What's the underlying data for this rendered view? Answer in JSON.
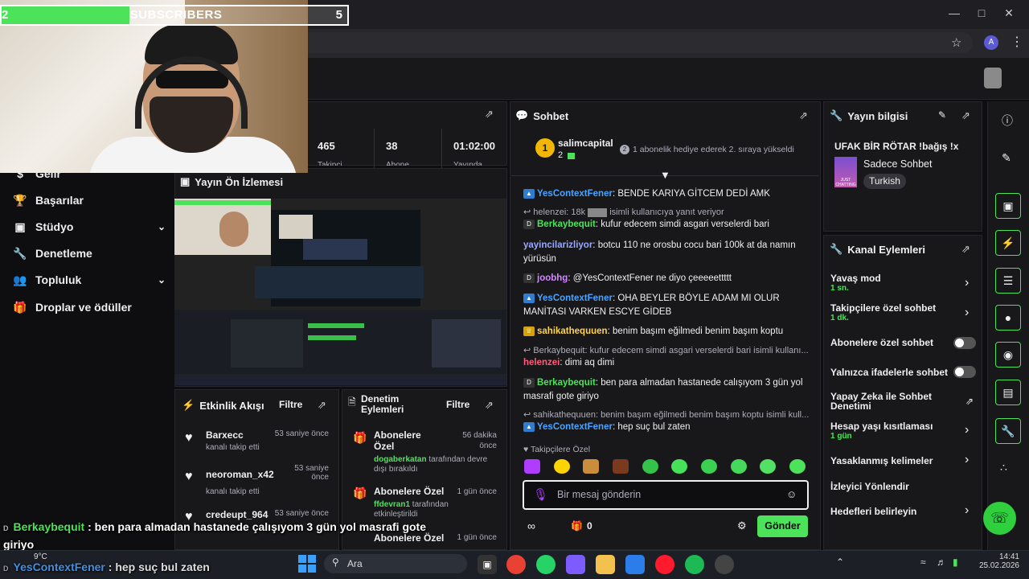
{
  "overlay": {
    "sub_left": "2",
    "sub_label": "SUBSCRIBERS",
    "sub_count": "5",
    "sub_progress": 0.37
  },
  "browser": {
    "profile": "A"
  },
  "nav": {
    "items": [
      {
        "label": "Gelir",
        "icon": "dollar-icon"
      },
      {
        "label": "Başarılar",
        "icon": "trophy-icon"
      },
      {
        "label": "Stüdyo",
        "icon": "studio-icon",
        "expandable": true
      },
      {
        "label": "Denetleme",
        "icon": "wrench-icon"
      },
      {
        "label": "Topluluk",
        "icon": "community-icon",
        "expandable": true
      },
      {
        "label": "Droplar ve ödüller",
        "icon": "drops-icon"
      }
    ]
  },
  "stats": {
    "values": [
      "465",
      "38",
      "01:02:00"
    ],
    "labels": [
      "Takipçi",
      "Abone",
      "Yayında"
    ]
  },
  "preview": {
    "title": "Yayın Ön İzlemesi"
  },
  "activity": {
    "title": "Etkinlik Akışı",
    "filter": "Filtre",
    "items": [
      {
        "user": "Barxecc",
        "desc": "kanalı takip etti",
        "time": "53 saniye önce"
      },
      {
        "user": "neoroman_x42",
        "desc": "kanalı takip etti",
        "time": "53 saniye önce"
      },
      {
        "user": "credeupt_964",
        "desc": "",
        "time": "53 saniye önce"
      }
    ]
  },
  "mod": {
    "title": "Denetim Eylemleri",
    "filter": "Filtre",
    "items": [
      {
        "title": "Abonelere Özel",
        "time": "56 dakika önce",
        "user": "dogaberkatan",
        "desc": "tarafından devre dışı bırakıldı"
      },
      {
        "title": "Abonelere Özel",
        "time": "1 gün önce",
        "user": "ffdevran1",
        "desc": "tarafından etkinleştirildi"
      },
      {
        "title": "Abonelere Özel",
        "time": "1 gün önce",
        "user": "",
        "desc": ""
      }
    ]
  },
  "chat": {
    "title": "Sohbet",
    "pinned_user": "salimcapital",
    "pinned_count": "2",
    "pinned_rank": "1",
    "pinned_msg": "1 abonelik hediye ederek 2. sıraya yükseldi",
    "messages": [
      {
        "user": "YesContextFener",
        "color": "#4aa3ff",
        "text": "BENDE KARIYA GİTCEM DEDİ AMK"
      },
      {
        "reply": "helenzei: 18k",
        "reply_tail": "isimli kullanıcıya yanıt veriyor",
        "user": "Berkaybequit",
        "color": "#4ce35a",
        "text": "kufur edecem simdi asgari verselerdi bari"
      },
      {
        "user": "yayincilarizliyor",
        "color": "#9aa8ff",
        "text": "botcu 110 ne orosbu cocu bari 100k at da namın yürüsün"
      },
      {
        "user": "joobhg",
        "color": "#d287ff",
        "text": "@YesContextFener ne diyo çeeeeettttt"
      },
      {
        "user": "YesContextFener",
        "color": "#4aa3ff",
        "text": "OHA BEYLER BÖYLE ADAM MI OLUR MANİTASI VARKEN ESCYE GİDEB"
      },
      {
        "user": "sahikathequuen",
        "color": "#ffd34d",
        "text": "benim başım eğilmedi benim başım koptu"
      },
      {
        "reply": "Berkaybequit: kufur edecem simdi asgari verselerdi bari isimli kullanı...",
        "user": "helenzei",
        "color": "#ff5c7a",
        "text": "dimi aq dimi"
      },
      {
        "user": "Berkaybequit",
        "color": "#4ce35a",
        "text": "ben para almadan hastanede calışıyom 3 gün yol masrafi gote giriyo"
      },
      {
        "reply": "sahikathequuen: benim başım eğilmedi benim başım koptu isimli kull...",
        "user": "YesContextFener",
        "color": "#4aa3ff",
        "text": "hep suç bul zaten"
      }
    ],
    "followers_only": "Takipçilere Özel",
    "input_placeholder": "Bir mesaj gönderin",
    "points": "0",
    "send": "Gönder"
  },
  "info": {
    "title": "Yayın bilgisi",
    "stream_title": "UFAK BİR RÖTAR !bağış !x",
    "category": "Sadece Sohbet",
    "language": "Turkish",
    "category_art": "JUST CHATTING"
  },
  "channel": {
    "title": "Kanal Eylemleri",
    "rows": [
      {
        "label": "Yavaş mod",
        "sub": "1 sn.",
        "control": "chevron"
      },
      {
        "label": "Takipçilere özel sohbet",
        "sub": "1 dk.",
        "control": "chevron"
      },
      {
        "label": "Abonelere özel sohbet",
        "sub": "",
        "control": "toggle"
      },
      {
        "label": "Yalnızca ifadelerle sohbet",
        "sub": "",
        "control": "toggle"
      },
      {
        "label": "Yapay Zeka ile Sohbet Denetimi",
        "sub": "",
        "control": "external"
      },
      {
        "label": "Hesap yaşı kısıtlaması",
        "sub": "1 gün",
        "control": "chevron"
      },
      {
        "label": "Yasaklanmış kelimeler",
        "sub": "",
        "control": "chevron"
      },
      {
        "label": "İzleyici Yönlendir",
        "sub": "",
        "control": "none"
      },
      {
        "label": "Hedefleri belirleyin",
        "sub": "",
        "control": "chevron"
      }
    ]
  },
  "captions": {
    "line1_user": "Berkaybequit",
    "line1_text": ": ben para almadan hastanede çalışıyom 3 gün yol masrafi gote",
    "line1_cont": "giriyo",
    "line2_user": "YesContextFener",
    "line2_text": ": hep suç bul zaten"
  },
  "taskbar": {
    "weather": "9°C",
    "search": "Ara",
    "time": "14:41",
    "date": "25.02.2026"
  }
}
